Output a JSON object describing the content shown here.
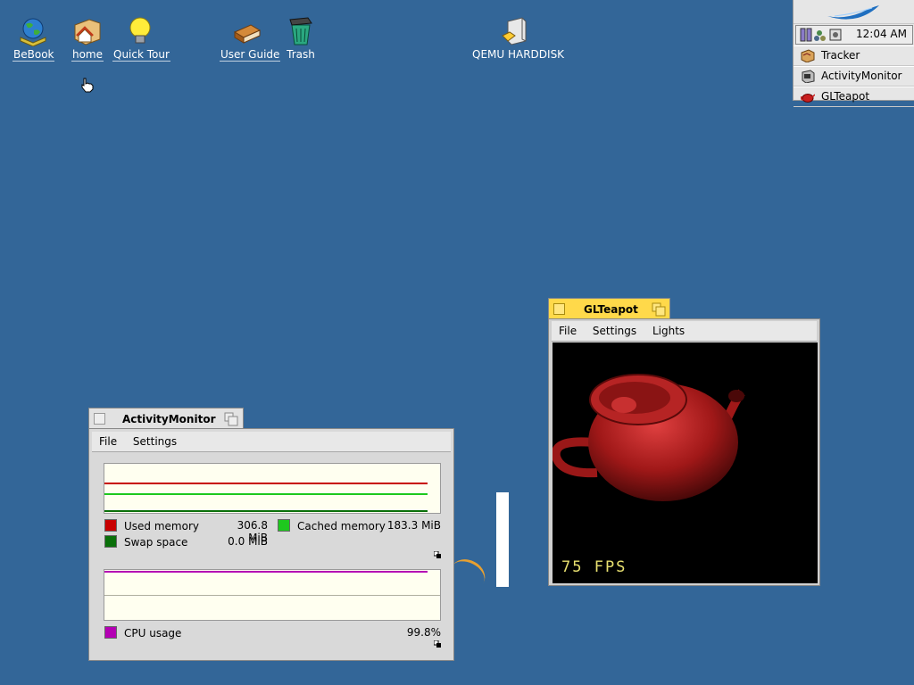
{
  "desktop": {
    "icons": [
      {
        "label": "BeBook",
        "icon": "globe-book-icon"
      },
      {
        "label": "home",
        "icon": "home-folder-icon"
      },
      {
        "label": "Quick Tour",
        "icon": "lightbulb-icon"
      },
      {
        "label": "User Guide",
        "icon": "book-icon"
      },
      {
        "label": "Trash",
        "icon": "trash-icon"
      },
      {
        "label": "QEMU HARDDISK",
        "icon": "harddisk-icon"
      }
    ]
  },
  "deskbar": {
    "clock": "12:04 AM",
    "items": [
      {
        "label": "Tracker",
        "icon": "tracker-icon"
      },
      {
        "label": "ActivityMonitor",
        "icon": "activity-monitor-icon"
      },
      {
        "label": "GLTeapot",
        "icon": "teapot-icon"
      }
    ]
  },
  "glteapot": {
    "title": "GLTeapot",
    "menu": [
      "File",
      "Settings",
      "Lights"
    ],
    "fps": "75 FPS",
    "colors": {
      "teapot": "#b81f1f",
      "tab": "#ffd94a"
    }
  },
  "activity_monitor": {
    "title": "ActivityMonitor",
    "menu": [
      "File",
      "Settings"
    ],
    "memory_legend": [
      {
        "label": "Used memory",
        "value": "306.8 MiB",
        "color": "#c80000"
      },
      {
        "label": "Cached memory",
        "value": "183.3 MiB",
        "color": "#1ec81e"
      },
      {
        "label": "Swap space",
        "value": "0.0 MiB",
        "color": "#0a700a"
      }
    ],
    "cpu_legend": {
      "label": "CPU usage",
      "value": "99.8%",
      "color": "#b400b4"
    }
  }
}
